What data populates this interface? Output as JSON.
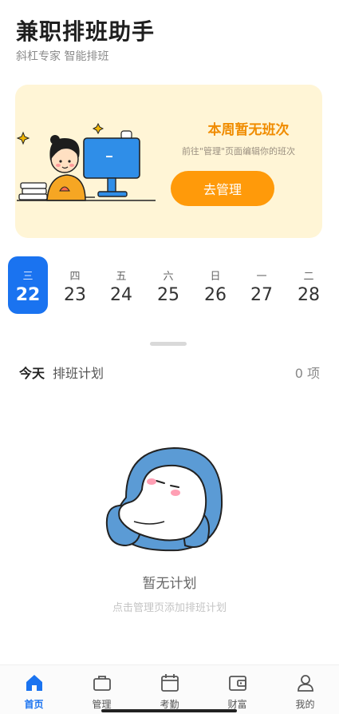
{
  "header": {
    "title": "兼职排班助手",
    "subtitle": "斜杠专家 智能排班"
  },
  "banner": {
    "title": "本周暂无班次",
    "description": "前往\"管理\"页面编辑你的班次",
    "button_label": "去管理"
  },
  "week": {
    "days": [
      {
        "weekday": "三",
        "date": "22",
        "selected": true
      },
      {
        "weekday": "四",
        "date": "23",
        "selected": false
      },
      {
        "weekday": "五",
        "date": "24",
        "selected": false
      },
      {
        "weekday": "六",
        "date": "25",
        "selected": false
      },
      {
        "weekday": "日",
        "date": "26",
        "selected": false
      },
      {
        "weekday": "一",
        "date": "27",
        "selected": false
      },
      {
        "weekday": "二",
        "date": "28",
        "selected": false
      }
    ]
  },
  "plan": {
    "today_label": "今天",
    "section_label": "排班计划",
    "count": "0 项"
  },
  "empty_state": {
    "title": "暂无计划",
    "description": "点击管理页添加排班计划"
  },
  "tabbar": {
    "tabs": [
      {
        "label": "首页",
        "icon": "home-icon",
        "active": true
      },
      {
        "label": "管理",
        "icon": "briefcase-icon",
        "active": false
      },
      {
        "label": "考勤",
        "icon": "calendar-icon",
        "active": false
      },
      {
        "label": "财富",
        "icon": "wallet-icon",
        "active": false
      },
      {
        "label": "我的",
        "icon": "user-icon",
        "active": false
      }
    ]
  },
  "colors": {
    "accent": "#1a73f0",
    "banner_bg": "#fff5d6",
    "banner_button": "#ff9a0a",
    "banner_title": "#f08c00"
  }
}
